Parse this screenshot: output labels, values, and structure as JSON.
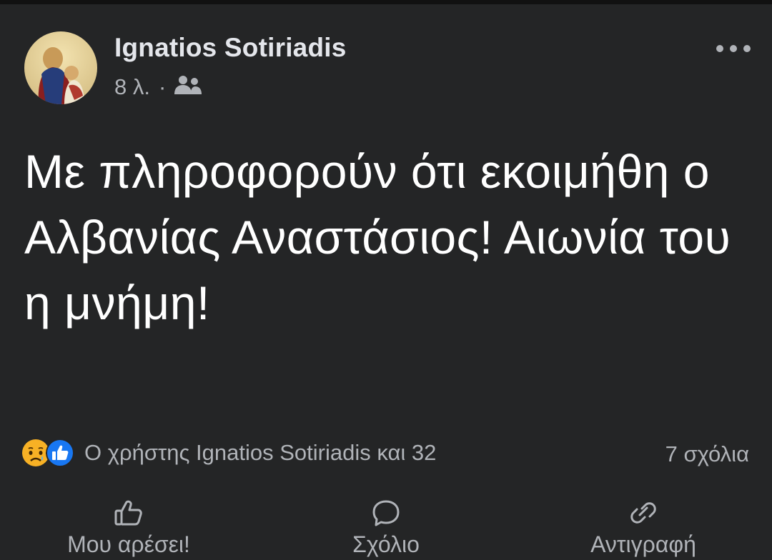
{
  "post": {
    "author_name": "Ignatios Sotiriadis",
    "timestamp": "8 λ.",
    "separator": "·",
    "avatar_icon": "religious-icon-avatar",
    "audience_icon": "friends-icon",
    "more_icon": "more-dots-icon",
    "text": "Με πληροφορούν ότι εκοιμήθη ο Αλβανίας Αναστάσιος! Αιωνία του η μνήμη!"
  },
  "reactions": {
    "icons": [
      "sad-reaction-icon",
      "like-reaction-icon"
    ],
    "summary": "Ο χρήστης Ignatios Sotiriadis και 32",
    "comments": "7 σχόλια"
  },
  "actions": [
    {
      "label": "Μου αρέσει!",
      "icon": "thumbs-up-icon"
    },
    {
      "label": "Σχόλιο",
      "icon": "comment-bubble-icon"
    },
    {
      "label": "Αντιγραφή",
      "icon": "link-icon"
    }
  ],
  "colors": {
    "background": "#242526",
    "primary_text": "#e4e6eb",
    "secondary_text": "#b0b3b8",
    "like_blue": "#1877f2",
    "sad_yellow": "#f7b125"
  }
}
